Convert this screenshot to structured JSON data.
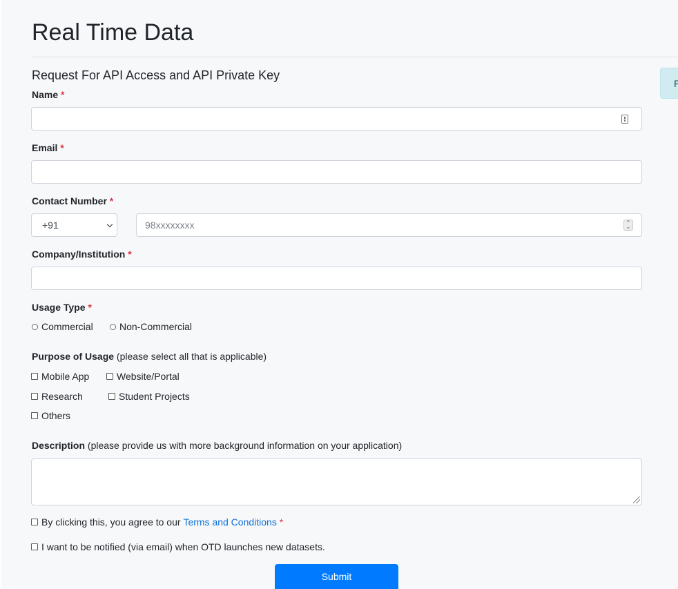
{
  "page": {
    "title": "Real Time Data",
    "side_alert_text": "F"
  },
  "form": {
    "heading": "Request For API Access and API Private Key",
    "name_label": "Name",
    "email_label": "Email",
    "contact_label": "Contact Number",
    "country_code": "+91",
    "phone_placeholder": "98xxxxxxxx",
    "company_label": "Company/Institution",
    "usage_type_label": "Usage Type",
    "usage_types": [
      "Commercial",
      "Non-Commercial"
    ],
    "purpose_label": "Purpose of Usage",
    "purpose_hint": "(please select all that is applicable)",
    "purposes": [
      "Mobile App",
      "Website/Portal",
      "Research",
      "Student Projects",
      "Others"
    ],
    "description_label": "Description",
    "description_hint": "(please provide us with more background information on your application)",
    "terms_prefix": "By clicking this, you agree to our",
    "terms_link": "Terms and Conditions",
    "notify_label": "I want to be notified (via email) when OTD launches new datasets.",
    "required_mark": "*",
    "submit_label": "Submit"
  },
  "colors": {
    "required": "#dc3545",
    "link": "#0a70d6",
    "primary_button": "#007bff",
    "alert_bg": "#d1ecf1"
  }
}
